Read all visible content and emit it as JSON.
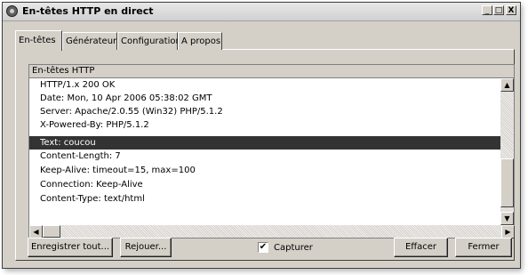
{
  "window": {
    "title": "En-têtes HTTP en direct",
    "buttons": {
      "minimize": "_",
      "maximize": "□",
      "close": "X"
    }
  },
  "tabs": [
    {
      "label": "En-têtes",
      "active": true
    },
    {
      "label": "Générateur",
      "active": false
    },
    {
      "label": "Configuration",
      "active": false
    },
    {
      "label": "A propos",
      "active": false
    }
  ],
  "headers_list": {
    "column_header": "En-têtes HTTP",
    "rows": [
      "HTTP/1.x 200 OK",
      "Date: Mon, 10 Apr 2006 05:38:02 GMT",
      "Server: Apache/2.0.55 (Win32) PHP/5.1.2",
      "X-Powered-By: PHP/5.1.2",
      "Text: coucou",
      "Content-Length: 7",
      "Keep-Alive: timeout=15, max=100",
      "Connection: Keep-Alive",
      "Content-Type: text/html"
    ],
    "selected_index": 4
  },
  "actions": {
    "save_all": "Enregistrer tout...",
    "replay": "Rejouer...",
    "capture_label": "Capturer",
    "capture_checked": true,
    "clear": "Effacer",
    "close": "Fermer"
  },
  "colors": {
    "selection_bg": "#333333",
    "face": "#d4d0c8"
  }
}
